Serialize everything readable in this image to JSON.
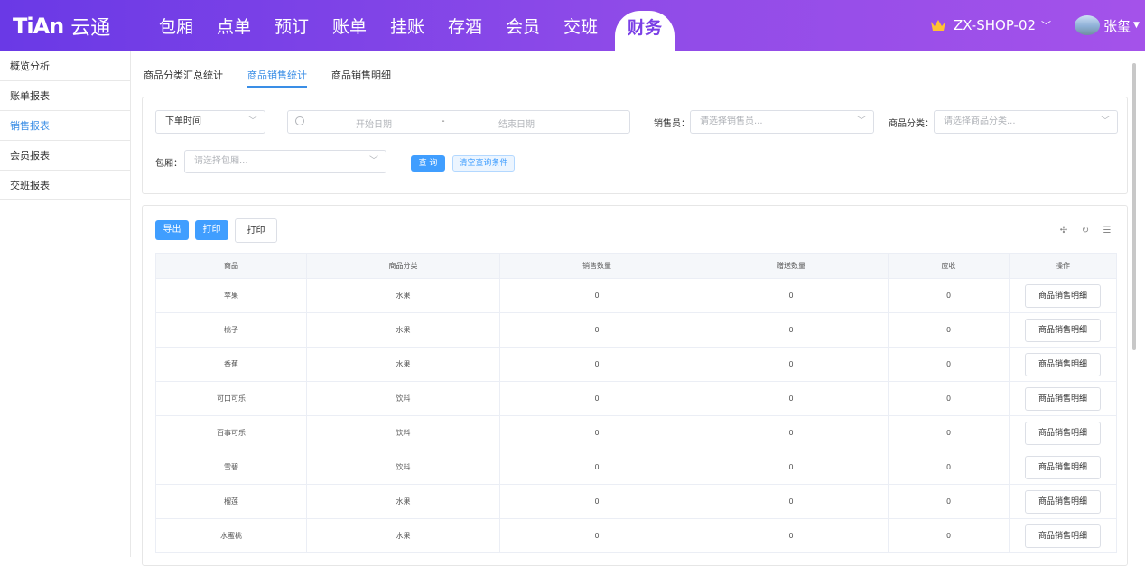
{
  "header": {
    "logo_mark": "TiAn",
    "logo_text": "云通",
    "nav": [
      "包厢",
      "点单",
      "预订",
      "账单",
      "挂账",
      "存酒",
      "会员",
      "交班"
    ],
    "nav_active": "财务",
    "shop_name": "ZX-SHOP-02",
    "user_name": "张玺"
  },
  "sidebar": {
    "items": [
      "概览分析",
      "账单报表",
      "销售报表",
      "会员报表",
      "交班报表"
    ],
    "active_index": 2
  },
  "tabs": [
    "商品分类汇总统计",
    "商品销售统计",
    "商品销售明细"
  ],
  "filters": {
    "time_select": "下单时间",
    "date_start_placeholder": "开始日期",
    "date_sep": "-",
    "date_end_placeholder": "结束日期",
    "seller_label": "销售员：",
    "seller_placeholder": "请选择销售员...",
    "category_label": "商品分类：",
    "category_placeholder": "请选择商品分类...",
    "room_label": "包厢：",
    "room_placeholder": "请选择包厢...",
    "query_button": "查 询",
    "clear_button": "清空查询条件"
  },
  "toolbar": {
    "export": "导出",
    "print1": "打印",
    "print2": "打印"
  },
  "table": {
    "columns": [
      "商品",
      "商品分类",
      "销售数量",
      "赠送数量",
      "应收",
      "操作"
    ],
    "action_label": "商品销售明细",
    "rows": [
      {
        "product": "苹果",
        "category": "水果",
        "sold": "0",
        "gift": "0",
        "receivable": "0"
      },
      {
        "product": "桃子",
        "category": "水果",
        "sold": "0",
        "gift": "0",
        "receivable": "0"
      },
      {
        "product": "香蕉",
        "category": "水果",
        "sold": "0",
        "gift": "0",
        "receivable": "0"
      },
      {
        "product": "可口可乐",
        "category": "饮料",
        "sold": "0",
        "gift": "0",
        "receivable": "0"
      },
      {
        "product": "百事可乐",
        "category": "饮料",
        "sold": "0",
        "gift": "0",
        "receivable": "0"
      },
      {
        "product": "雪碧",
        "category": "饮料",
        "sold": "0",
        "gift": "0",
        "receivable": "0"
      },
      {
        "product": "榴莲",
        "category": "水果",
        "sold": "0",
        "gift": "0",
        "receivable": "0"
      },
      {
        "product": "水蜜桃",
        "category": "水果",
        "sold": "0",
        "gift": "0",
        "receivable": "0"
      }
    ]
  },
  "colors": {
    "header_start": "#6a39e6",
    "header_end": "#a452ea",
    "accent": "#409eff",
    "active_nav": "#7a3fe6"
  }
}
